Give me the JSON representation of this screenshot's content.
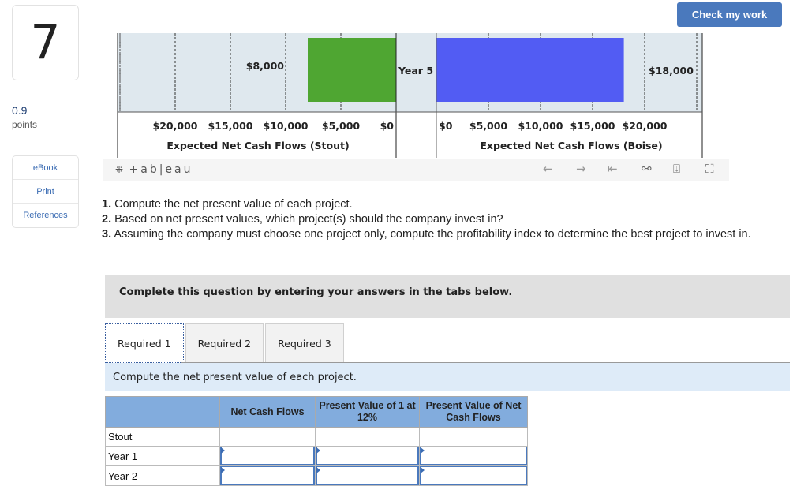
{
  "question": {
    "number": "7",
    "points_value": "0.9",
    "points_label": "points"
  },
  "sidebar": {
    "links": [
      {
        "label": "eBook"
      },
      {
        "label": "Print"
      },
      {
        "label": "References"
      }
    ]
  },
  "header": {
    "check_button": "Check my work"
  },
  "chart_data": {
    "type": "bar",
    "orientation": "horizontal-butterfly",
    "category_label": "Year 5",
    "left_panel": {
      "series": "Stout",
      "xlabel": "Expected Net Cash Flows (Stout)",
      "value": 8000,
      "data_label": "$8,000",
      "color": "#4fa632",
      "ticks": [
        "$20,000",
        "$15,000",
        "$10,000",
        "$5,000",
        "$0"
      ],
      "tick_values": [
        20000,
        15000,
        10000,
        5000,
        0
      ],
      "xlim": [
        0,
        25000
      ],
      "direction": "reversed"
    },
    "right_panel": {
      "series": "Boise",
      "xlabel": "Expected Net Cash Flows (Boise)",
      "value": 18000,
      "data_label": "$18,000",
      "color": "#525cf3",
      "ticks": [
        "$0",
        "$5,000",
        "$10,000",
        "$15,000",
        "$20,000"
      ],
      "tick_values": [
        0,
        5000,
        10000,
        15000,
        20000
      ],
      "xlim": [
        0,
        23000
      ]
    },
    "grid": "dashed vertical",
    "background": "#dfe8ee"
  },
  "viz_toolbar": {
    "logo": "+ab|eau",
    "icons": [
      "undo-icon",
      "redo-icon",
      "revert-icon",
      "share-icon",
      "download-icon",
      "fullscreen-icon"
    ]
  },
  "instructions": [
    {
      "num": "1.",
      "text": " Compute the net present value of each project."
    },
    {
      "num": "2.",
      "text": " Based on net present values, which project(s) should the company invest in?"
    },
    {
      "num": "3.",
      "text": " Assuming the company must choose one project only, compute the profitability index to determine the best project to invest in."
    }
  ],
  "banner": "Complete this question by entering your answers in the tabs below.",
  "tabs": [
    {
      "label": "Required 1",
      "active": true
    },
    {
      "label": "Required 2",
      "active": false
    },
    {
      "label": "Required 3",
      "active": false
    }
  ],
  "tab_prompt": "Compute the net present value of each project.",
  "table": {
    "headers": [
      "",
      "Net Cash Flows",
      "Present Value of 1 at 12%",
      "Present Value of Net Cash Flows"
    ],
    "rows": [
      {
        "label": "Stout",
        "editable": false,
        "values": [
          "",
          "",
          ""
        ]
      },
      {
        "label": "Year 1",
        "editable": true,
        "values": [
          "",
          "",
          ""
        ]
      },
      {
        "label": "Year 2",
        "editable": true,
        "values": [
          "",
          "",
          ""
        ]
      }
    ]
  }
}
